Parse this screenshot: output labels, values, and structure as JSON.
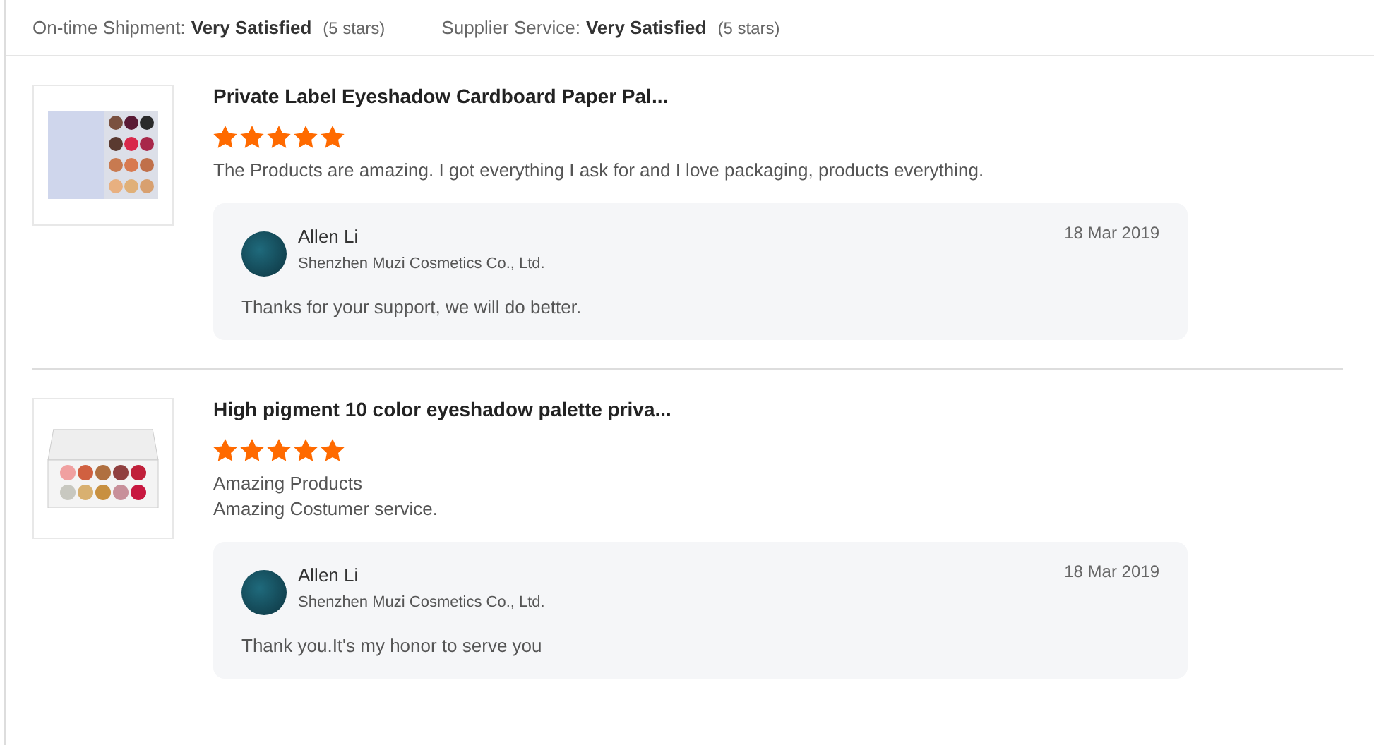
{
  "ratings_summary": [
    {
      "label": "On-time Shipment:",
      "value": "Very Satisfied",
      "note": "(5 stars)"
    },
    {
      "label": "Supplier Service:",
      "value": "Very Satisfied",
      "note": "(5 stars)"
    }
  ],
  "reviews": [
    {
      "product_title": "Private Label Eyeshadow Cardboard Paper Pal...",
      "stars": 5,
      "kind": "square",
      "comment_lines": [
        "The Products are amazing.  I got everything I ask for and I love packaging, products everything."
      ],
      "reply": {
        "name": "Allen Li",
        "company": "Shenzhen Muzi Cosmetics Co., Ltd.",
        "date": "18 Mar 2019",
        "text": "Thanks for your support, we will do better."
      }
    },
    {
      "product_title": "High pigment 10 color eyeshadow palette priva...",
      "stars": 5,
      "kind": "wide",
      "comment_lines": [
        "Amazing Products",
        "Amazing Costumer service."
      ],
      "reply": {
        "name": "Allen Li",
        "company": "Shenzhen Muzi Cosmetics Co., Ltd.",
        "date": "18 Mar 2019",
        "text": "Thank you.It's my honor to serve you"
      }
    }
  ]
}
